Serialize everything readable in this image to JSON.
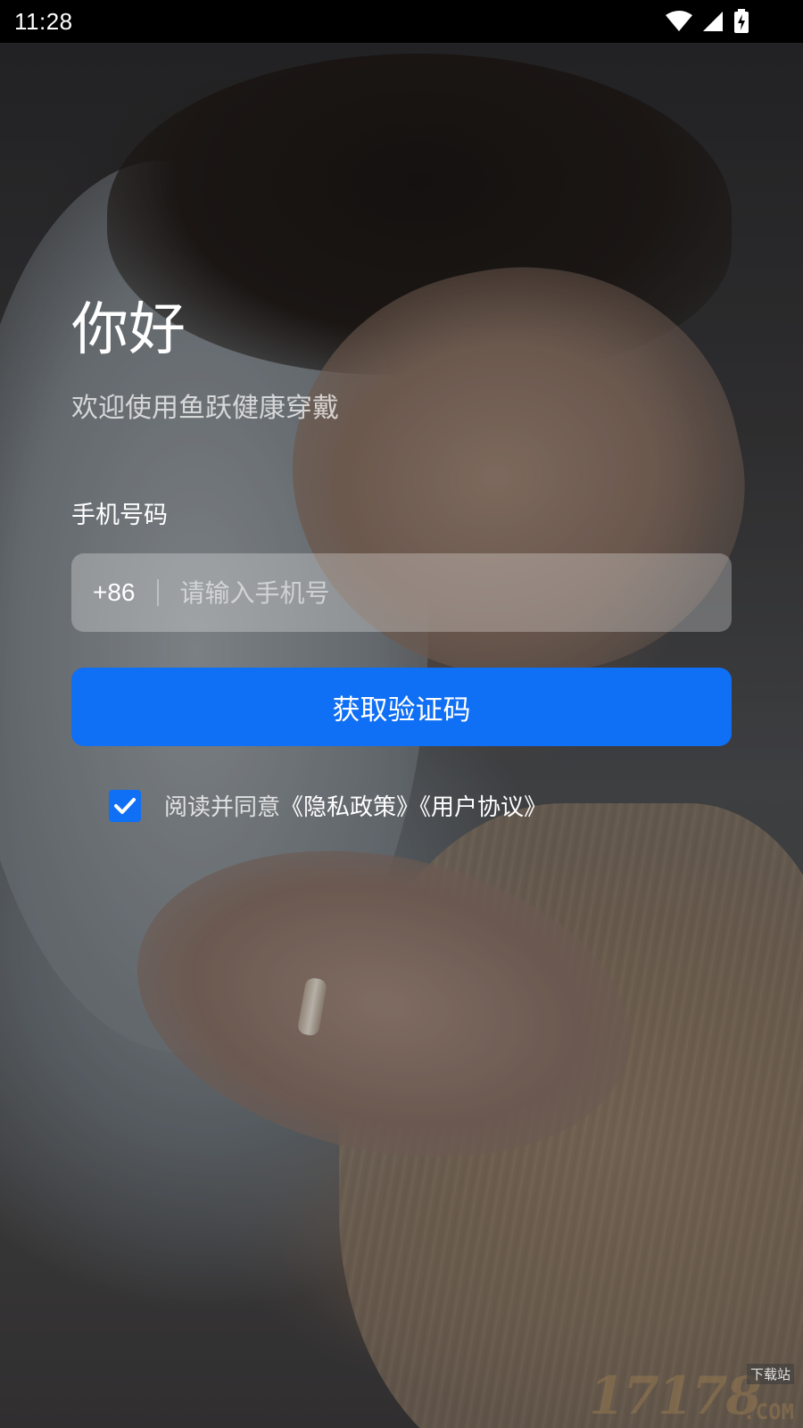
{
  "status_bar": {
    "time": "11:28",
    "icons": [
      "wifi-icon",
      "cellular-signal-icon",
      "battery-charging-icon"
    ]
  },
  "background": {
    "description_icon": "sleeping-woman-photo"
  },
  "login": {
    "greeting": "你好",
    "subtitle": "欢迎使用鱼跃健康穿戴",
    "phone_label": "手机号码",
    "country_code": "+86",
    "phone_placeholder": "请输入手机号",
    "phone_value": "",
    "get_code_label": "获取验证码",
    "agreement": {
      "checked": true,
      "prefix": "阅读并同意",
      "privacy_link": "《隐私政策》",
      "terms_link": "《用户协议》"
    }
  },
  "watermark": {
    "number": "17178",
    "tag": "下载站",
    "suffix": ".COM"
  },
  "colors": {
    "accent": "#0f6ff5",
    "status_bar": "#000000"
  }
}
